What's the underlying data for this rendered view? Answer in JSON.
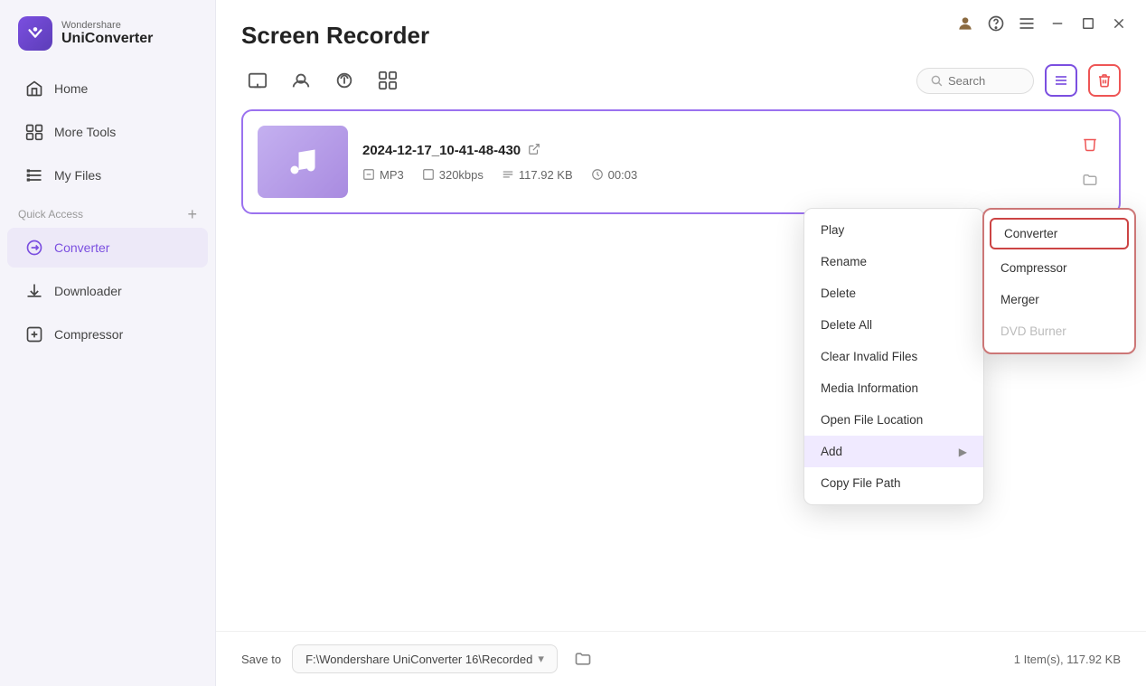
{
  "app": {
    "brand": "Wondershare",
    "product": "UniConverter",
    "page_title": "Screen Recorder"
  },
  "sidebar": {
    "nav_items": [
      {
        "id": "home",
        "label": "Home",
        "icon": "home-icon"
      },
      {
        "id": "more-tools",
        "label": "More Tools",
        "icon": "tools-icon"
      },
      {
        "id": "my-files",
        "label": "My Files",
        "icon": "files-icon"
      }
    ],
    "quick_access_label": "Quick Access",
    "quick_access_items": [
      {
        "id": "converter",
        "label": "Converter",
        "icon": "converter-icon"
      },
      {
        "id": "downloader",
        "label": "Downloader",
        "icon": "downloader-icon"
      },
      {
        "id": "compressor",
        "label": "Compressor",
        "icon": "compressor-icon"
      }
    ]
  },
  "toolbar": {
    "search_placeholder": "Search"
  },
  "file": {
    "name": "2024-12-17_10-41-48-430",
    "format": "MP3",
    "bitrate": "320kbps",
    "size": "117.92 KB",
    "duration": "00:03"
  },
  "context_menu": {
    "items": [
      {
        "id": "play",
        "label": "Play",
        "has_arrow": false
      },
      {
        "id": "rename",
        "label": "Rename",
        "has_arrow": false
      },
      {
        "id": "delete",
        "label": "Delete",
        "has_arrow": false
      },
      {
        "id": "delete-all",
        "label": "Delete All",
        "has_arrow": false
      },
      {
        "id": "clear-invalid",
        "label": "Clear Invalid Files",
        "has_arrow": false
      },
      {
        "id": "media-info",
        "label": "Media Information",
        "has_arrow": false
      },
      {
        "id": "open-location",
        "label": "Open File Location",
        "has_arrow": false
      },
      {
        "id": "add",
        "label": "Add",
        "has_arrow": true
      },
      {
        "id": "copy-path",
        "label": "Copy File Path",
        "has_arrow": false
      }
    ]
  },
  "submenu": {
    "items": [
      {
        "id": "converter",
        "label": "Converter",
        "disabled": false,
        "highlighted": true
      },
      {
        "id": "compressor",
        "label": "Compressor",
        "disabled": false
      },
      {
        "id": "merger",
        "label": "Merger",
        "disabled": false
      },
      {
        "id": "dvd-burner",
        "label": "DVD Burner",
        "disabled": true
      }
    ]
  },
  "footer": {
    "save_to_label": "Save to",
    "path": "F:\\Wondershare UniConverter 16\\Recorded",
    "info": "1 Item(s), 117.92 KB"
  },
  "window": {
    "minimize": "−",
    "maximize": "□",
    "close": "✕"
  }
}
